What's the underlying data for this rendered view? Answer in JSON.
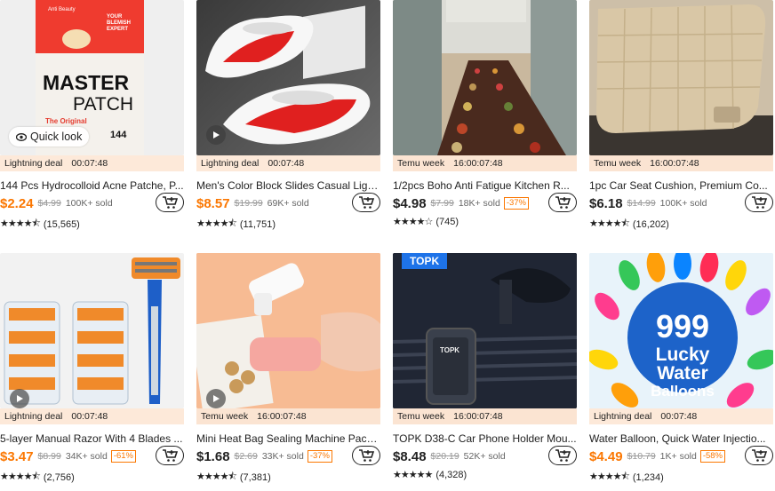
{
  "products": [
    {
      "title": "144 Pcs Hydrocolloid Acne Patche, P...",
      "price": "$2.24",
      "price_color": "orange",
      "original": "$4.99",
      "sold": "100K+ sold",
      "discount": "",
      "deal": "Lightning deal",
      "timer": "00:07:48",
      "stars": 4.5,
      "reviews": "(15,565)",
      "has_quicklook": true,
      "has_play": false,
      "art": {
        "brand": "Anti Beauty",
        "tagline": "YOUR BLEMISH EXPERT",
        "big1": "MASTER",
        "big2": "PATCH",
        "orig_line": "The Original",
        "count": "144"
      }
    },
    {
      "title": "Men's Color Block Slides Casual Ligh...",
      "price": "$8.57",
      "price_color": "orange",
      "original": "$19.99",
      "sold": "69K+ sold",
      "discount": "",
      "deal": "Lightning deal",
      "timer": "00:07:48",
      "stars": 4.5,
      "reviews": "(11,751)",
      "has_quicklook": false,
      "has_play": true
    },
    {
      "title": "1/2pcs Boho Anti Fatigue Kitchen R...",
      "price": "$4.98",
      "price_color": "black",
      "original": "$7.99",
      "sold": "18K+ sold",
      "discount": "-37%",
      "deal": "Temu week",
      "timer": "16:00:07:48",
      "stars": 4.0,
      "reviews": "(745)",
      "has_quicklook": false,
      "has_play": false
    },
    {
      "title": "1pc Car Seat Cushion, Premium Co...",
      "price": "$6.18",
      "price_color": "black",
      "original": "$14.99",
      "sold": "100K+ sold",
      "discount": "",
      "deal": "Temu week",
      "timer": "16:00:07:48",
      "stars": 4.5,
      "reviews": "(16,202)",
      "has_quicklook": false,
      "has_play": false
    },
    {
      "title": "5-layer Manual Razor With 4 Blades ...",
      "price": "$3.47",
      "price_color": "orange",
      "original": "$8.99",
      "sold": "34K+ sold",
      "discount": "-61%",
      "deal": "Lightning deal",
      "timer": "00:07:48",
      "stars": 4.5,
      "reviews": "(2,756)",
      "has_quicklook": false,
      "has_play": true
    },
    {
      "title": "Mini Heat Bag Sealing Machine Pack...",
      "price": "$1.68",
      "price_color": "black",
      "original": "$2.69",
      "sold": "33K+ sold",
      "discount": "-37%",
      "deal": "Temu week",
      "timer": "16:00:07:48",
      "stars": 4.5,
      "reviews": "(7,381)",
      "has_quicklook": false,
      "has_play": true
    },
    {
      "title": "TOPK D38-C Car Phone Holder Mou...",
      "price": "$8.48",
      "price_color": "black",
      "original": "$20.19",
      "sold": "52K+ sold",
      "discount": "",
      "deal": "Temu week",
      "timer": "16:00:07:48",
      "stars": 5.0,
      "reviews": "(4,328)",
      "has_quicklook": false,
      "has_play": false,
      "art": {
        "tag": "TOPK",
        "phone_brand": "TOPK"
      }
    },
    {
      "title": "Water Balloon, Quick Water Injectio...",
      "price": "$4.49",
      "price_color": "orange",
      "original": "$10.79",
      "sold": "1K+ sold",
      "discount": "-58%",
      "deal": "Lightning deal",
      "timer": "00:07:48",
      "stars": 4.5,
      "reviews": "(1,234)",
      "has_quicklook": false,
      "has_play": true,
      "art": {
        "line1": "999",
        "line2": "Lucky",
        "line3": "Water",
        "line4": "Balloons"
      }
    }
  ],
  "ui": {
    "quick_look": "Quick look",
    "cart_icon": "add-to-cart-icon",
    "play_icon": "play-icon",
    "eye_icon": "eye-icon",
    "star_icon": "star-icon"
  },
  "colors": {
    "accent": "#fb7701",
    "deal_bg": "#fde9d9",
    "text": "#222222",
    "muted": "#999999"
  }
}
